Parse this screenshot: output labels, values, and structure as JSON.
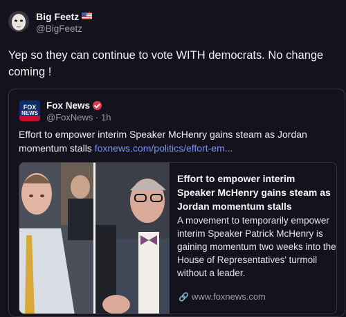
{
  "post": {
    "author_name": "Big Feetz",
    "author_flag": "us-flag-icon",
    "author_handle": "@BigFeetz",
    "text": "Yep so they can continue to vote WITH democrats.  No change coming !"
  },
  "quote": {
    "author_name": "Fox News",
    "verified_icon": "verified-badge-icon",
    "author_handle": "@FoxNews",
    "separator": "·",
    "time": "1h",
    "logo_text_top": "FOX",
    "logo_text_bottom": "NEWS",
    "text": "Effort to empower interim Speaker McHenry gains steam as Jordan momentum stalls ",
    "link_text": "foxnews.com/politics/effort-em...",
    "card": {
      "title": "Effort to empower interim Speaker McHenry gains steam as Jordan momentum stalls",
      "description": "A movement to temporarily empower interim Speaker Patrick McHenry is gaining momentum two weeks into the House of Representatives' turmoil without a leader.",
      "domain": "www.foxnews.com",
      "domain_icon": "link-icon"
    }
  },
  "colors": {
    "background": "#14121c",
    "link": "#7a93f2",
    "muted": "#9e9aab",
    "border": "#37333f",
    "verified": "#e23a4a"
  }
}
